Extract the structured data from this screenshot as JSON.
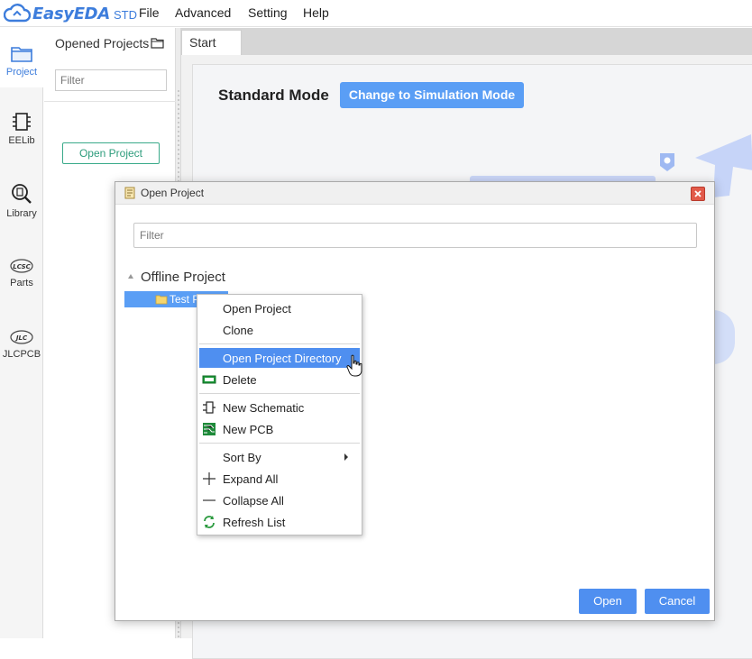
{
  "app": {
    "logo_text": "EasyEDA",
    "logo_suffix": "STD",
    "brand_color": "#3d7ddc",
    "menu": [
      "File",
      "Advanced",
      "Setting",
      "Help"
    ]
  },
  "leftnav": {
    "items": [
      {
        "label": "Project",
        "icon": "folder-icon",
        "active": true
      },
      {
        "label": "EELib",
        "icon": "chip-icon"
      },
      {
        "label": "Library",
        "icon": "library-search-icon"
      },
      {
        "label": "Parts",
        "icon": "lcsc-icon"
      },
      {
        "label": "JLCPCB",
        "icon": "jlc-icon"
      }
    ]
  },
  "project_panel": {
    "title": "Opened Projects",
    "filter_placeholder": "Filter",
    "open_button": "Open Project"
  },
  "tabs": [
    {
      "label": "Start",
      "active": true
    }
  ],
  "start_page": {
    "mode_label": "Standard Mode",
    "switch_button": "Change to Simulation Mode"
  },
  "dialog": {
    "title": "Open Project",
    "filter_placeholder": "Filter",
    "tree": {
      "root": "Offline Project",
      "selected_item": "Test Project"
    },
    "open_button": "Open",
    "cancel_button": "Cancel"
  },
  "context_menu": {
    "items": [
      {
        "label": "Open Project"
      },
      {
        "label": "Clone"
      },
      {
        "label": "Open Project Directory",
        "highlighted": true
      },
      {
        "label": "Delete",
        "icon": "delete-icon"
      },
      {
        "label": "New Schematic",
        "icon": "schematic-icon"
      },
      {
        "label": "New PCB",
        "icon": "pcb-icon"
      },
      {
        "label": "Sort By",
        "has_submenu": true
      },
      {
        "label": "Expand All",
        "icon": "plus-icon"
      },
      {
        "label": "Collapse All",
        "icon": "minus-icon"
      },
      {
        "label": "Refresh List",
        "icon": "refresh-icon"
      }
    ]
  }
}
